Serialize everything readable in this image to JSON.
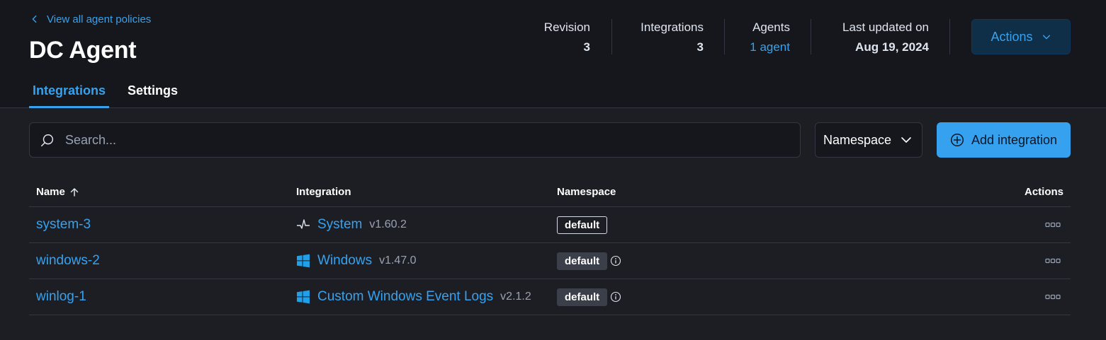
{
  "header": {
    "back_link": "View all agent policies",
    "title": "DC Agent",
    "stats": {
      "revision": {
        "label": "Revision",
        "value": "3"
      },
      "integrations": {
        "label": "Integrations",
        "value": "3"
      },
      "agents": {
        "label": "Agents",
        "value": "1 agent"
      },
      "last_updated": {
        "label": "Last updated on",
        "value": "Aug 19, 2024"
      }
    },
    "actions_label": "Actions",
    "tabs": [
      {
        "label": "Integrations",
        "active": true
      },
      {
        "label": "Settings",
        "active": false
      }
    ]
  },
  "toolbar": {
    "search_placeholder": "Search...",
    "namespace_label": "Namespace",
    "add_label": "Add integration"
  },
  "table": {
    "columns": [
      "Name",
      "Integration",
      "Namespace",
      "Actions"
    ],
    "rows": [
      {
        "name": "system-3",
        "integration": "System",
        "version": "v1.60.2",
        "icon": "system-pulse-icon",
        "namespace": "default",
        "badge_style": "outline",
        "info": false
      },
      {
        "name": "windows-2",
        "integration": "Windows",
        "version": "v1.47.0",
        "icon": "windows-logo-icon",
        "namespace": "default",
        "badge_style": "filled",
        "info": true
      },
      {
        "name": "winlog-1",
        "integration": "Custom Windows Event Logs",
        "version": "v2.1.2",
        "icon": "windows-logo-icon",
        "namespace": "default",
        "badge_style": "filled",
        "info": true
      }
    ]
  },
  "colors": {
    "accent": "#36a2ef",
    "header_bg": "#16171c",
    "page_bg": "#1d1e24",
    "border": "#343741"
  }
}
